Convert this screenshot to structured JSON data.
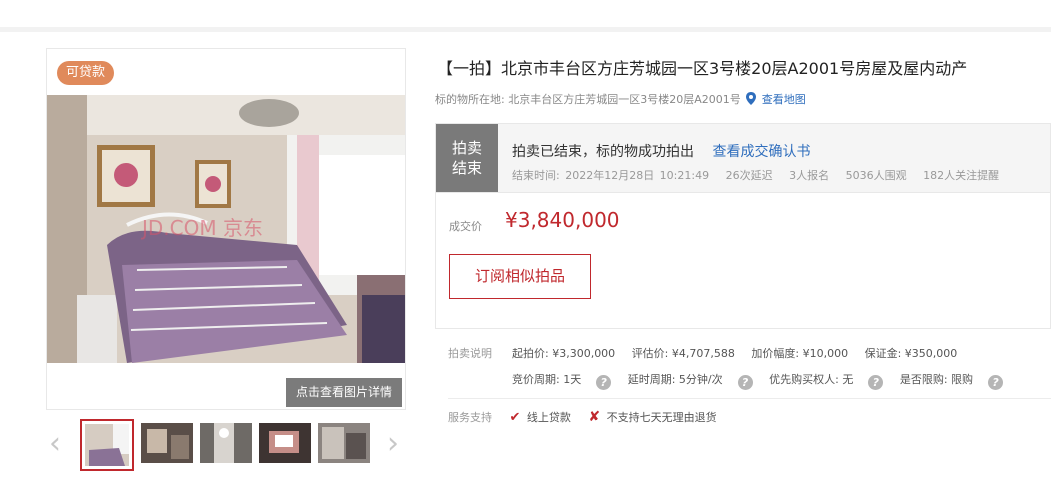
{
  "gallery": {
    "badge": "可贷款",
    "detail_button": "点击查看图片详情",
    "watermark": "JD.COM 京东",
    "prev_icon": "chevron-left-icon",
    "next_icon": "chevron-right-icon",
    "thumbnail_count": 5,
    "active_thumbnail": 1
  },
  "lot": {
    "title": "【一拍】北京市丰台区方庄芳城园一区3号楼20层A2001号房屋及屋内动产",
    "location_label": "标的物所在地:",
    "location_value": "北京丰台区方庄芳城园一区3号楼20层A2001号",
    "map_link": "查看地图"
  },
  "status": {
    "tag_line1": "拍卖",
    "tag_line2": "结束",
    "message": "拍卖已结束，标的物成功拍出",
    "confirm_link": "查看成交确认书",
    "end_time": "结束时间:  2022年12月28日 10:21:49",
    "delays": "26次延迟",
    "signups": "3人报名",
    "watchers": "5036人围观",
    "reminders": "182人关注提醒"
  },
  "price": {
    "label": "成交价",
    "value": "¥3,840,000",
    "subscribe_button": "订阅相似拍品"
  },
  "description": {
    "label": "拍卖说明",
    "starting_price": "起拍价: ¥3,300,000",
    "appraisal": "评估价: ¥4,707,588",
    "increment": "加价幅度: ¥10,000",
    "deposit": "保证金: ¥350,000",
    "bid_period": "竞价周期: 1天",
    "delay_period": "延时周期: 5分钟/次",
    "priority": "优先购买权人: 无",
    "restricted": "是否限购: 限购",
    "help_glyph": "?"
  },
  "service": {
    "label": "服务支持",
    "loan": "线上贷款",
    "no_return": "不支持七天无理由退货",
    "check_glyph": "✔",
    "cross_glyph": "✘"
  },
  "colors": {
    "accent_red": "#c0282d",
    "badge_orange": "#e08a5b",
    "link_blue": "#2f6ebd",
    "status_gray": "#7a7a7a"
  }
}
